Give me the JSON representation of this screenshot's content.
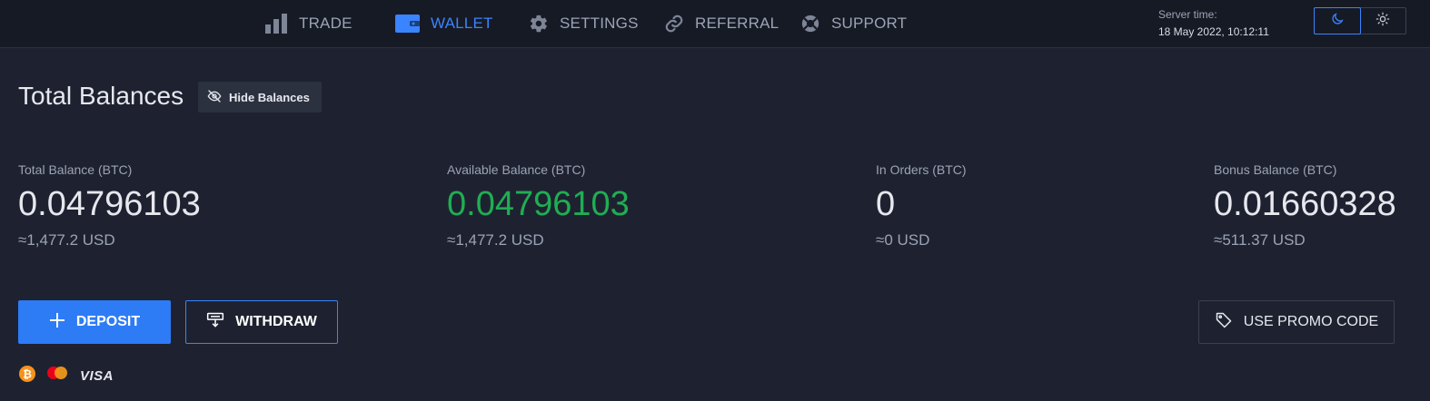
{
  "nav": {
    "items": [
      {
        "label": "TRADE",
        "icon": "bar-chart-icon"
      },
      {
        "label": "WALLET",
        "icon": "wallet-icon",
        "active": true
      },
      {
        "label": "SETTINGS",
        "icon": "gear-icon"
      },
      {
        "label": "REFERRAL",
        "icon": "link-icon"
      },
      {
        "label": "SUPPORT",
        "icon": "lifebuoy-icon"
      }
    ],
    "server_time_label": "Server time:",
    "server_time_value": "18 May 2022, 10:12:11",
    "theme": {
      "active": "dark",
      "options": [
        "moon-icon",
        "sun-icon"
      ]
    }
  },
  "header": {
    "title": "Total Balances",
    "hide_balances_label": "Hide Balances"
  },
  "balances": [
    {
      "label": "Total Balance (BTC)",
      "amount": "0.04796103",
      "usd": "≈1,477.2 USD",
      "highlight": false
    },
    {
      "label": "Available Balance (BTC)",
      "amount": "0.04796103",
      "usd": "≈1,477.2 USD",
      "highlight": true
    },
    {
      "label": "In Orders (BTC)",
      "amount": "0",
      "usd": "≈0 USD",
      "highlight": false
    },
    {
      "label": "Bonus Balance (BTC)",
      "amount": "0.01660328",
      "usd": "≈511.37 USD",
      "highlight": false
    }
  ],
  "actions": {
    "deposit_label": "DEPOSIT",
    "withdraw_label": "WITHDRAW",
    "promo_label": "USE PROMO CODE"
  },
  "payment_methods": {
    "icons": [
      "bitcoin-icon",
      "mastercard-icon"
    ],
    "visa_label": "VISA"
  },
  "colors": {
    "accent": "#3a84ff",
    "positive": "#1fae53",
    "background": "#1e2230",
    "topbar": "#161a25"
  }
}
